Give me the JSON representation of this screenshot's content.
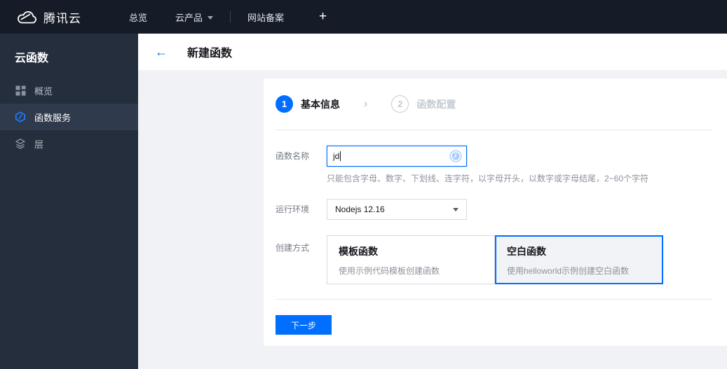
{
  "topnav": {
    "brand": "腾讯云",
    "items": [
      {
        "label": "总览"
      },
      {
        "label": "云产品"
      },
      {
        "label": "网站备案"
      }
    ],
    "plus": "+"
  },
  "sidebar": {
    "title": "云函数",
    "items": [
      {
        "label": "概览",
        "icon": "grid-icon",
        "active": false
      },
      {
        "label": "函数服务",
        "icon": "function-service-icon",
        "active": true
      },
      {
        "label": "层",
        "icon": "layers-icon",
        "active": false
      }
    ]
  },
  "page": {
    "back": "←",
    "title": "新建函数"
  },
  "wizard": {
    "steps": [
      {
        "number": "1",
        "label": "基本信息",
        "active": true
      },
      {
        "number": "2",
        "label": "函数配置",
        "active": false
      }
    ],
    "chevron": "›"
  },
  "form": {
    "name_label": "函数名称",
    "name_value": "jd",
    "name_hint": "只能包含字母、数字、下划线、连字符，以字母开头，以数字或字母结尾，2~60个字符",
    "name_status_icon": "pending-clock-icon",
    "runtime_label": "运行环境",
    "runtime_value": "Nodejs 12.16",
    "method_label": "创建方式",
    "methods": [
      {
        "title": "模板函数",
        "desc": "使用示例代码模板创建函数",
        "selected": false
      },
      {
        "title": "空白函数",
        "desc": "使用helloworld示例创建空白函数",
        "selected": true
      }
    ],
    "next_button": "下一步"
  },
  "colors": {
    "accent": "#006eff",
    "topnav_bg": "#151c28",
    "sidebar_bg": "#242e3c",
    "sidebar_active_bg": "#2f3a4c",
    "content_bg": "#f1f2f5",
    "selected_card_bg": "#f2f3f6",
    "inactive_step": "#c6ccd4"
  }
}
